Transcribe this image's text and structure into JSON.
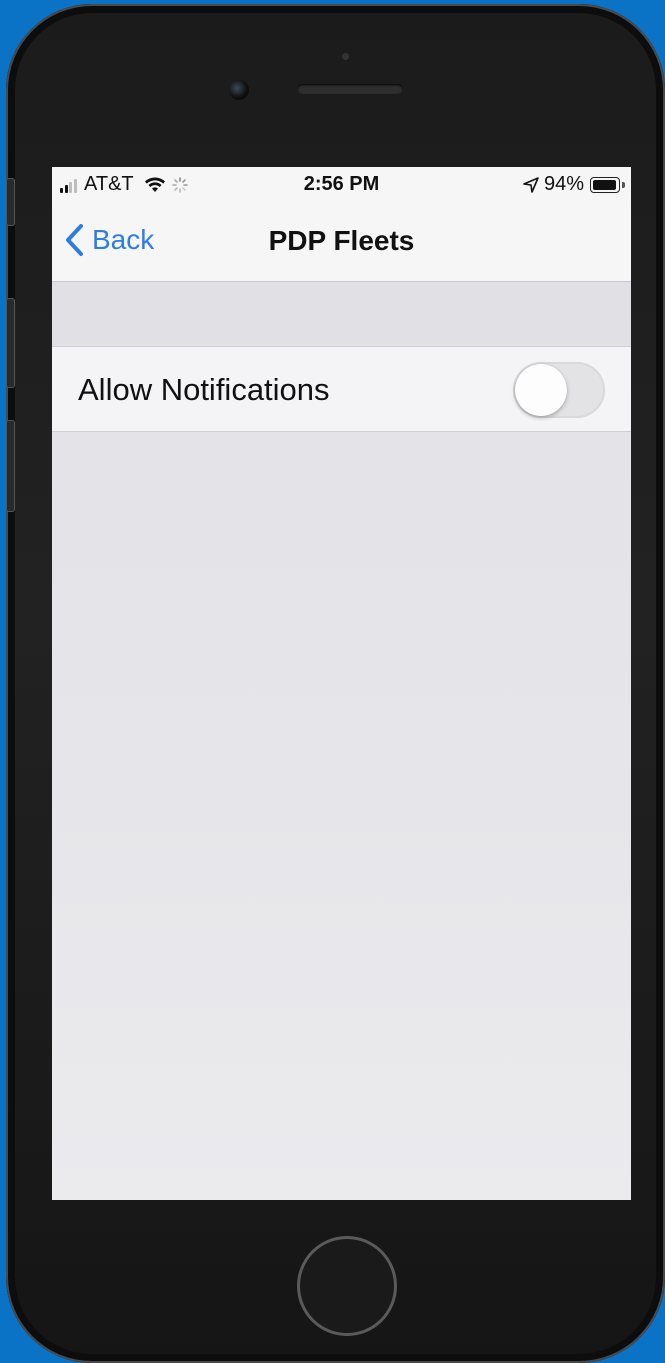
{
  "status_bar": {
    "carrier": "AT&T",
    "signal_bars_filled": 2,
    "signal_bars_total": 4,
    "time": "2:56 PM",
    "battery_percent": "94%",
    "battery_level": 0.94
  },
  "nav": {
    "back_label": "Back",
    "title": "PDP Fleets"
  },
  "settings": {
    "allow_notifications_label": "Allow Notifications",
    "allow_notifications_on": false
  },
  "colors": {
    "accent": "#2f7de1",
    "background_outer": "#0a73c6"
  },
  "icons": [
    "signal-bars-icon",
    "wifi-icon",
    "spinner-icon",
    "location-arrow-icon",
    "battery-icon",
    "back-chevron-icon"
  ]
}
